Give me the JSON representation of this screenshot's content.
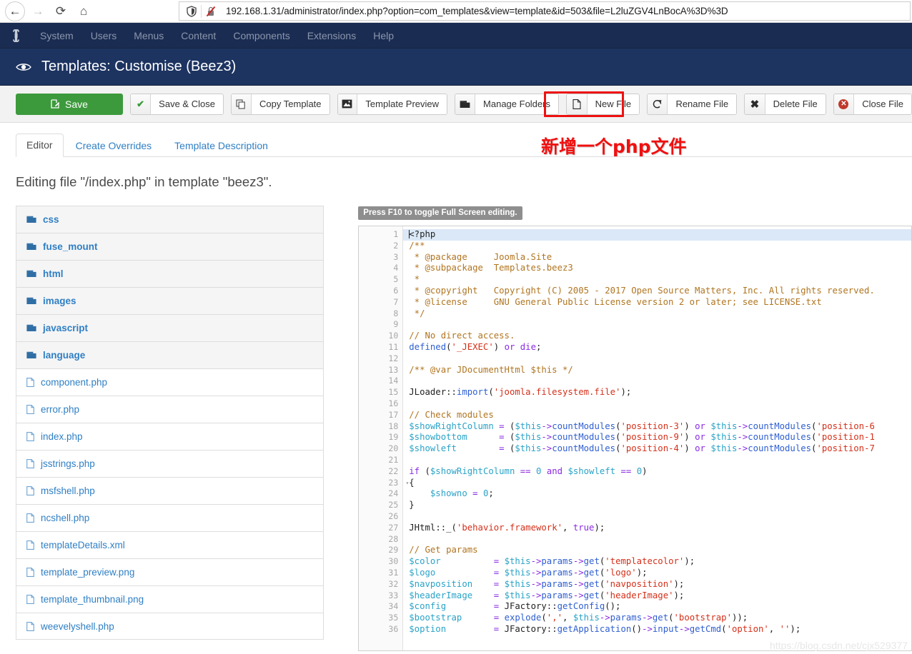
{
  "browser": {
    "back_icon": "back-arrow-icon",
    "forward_icon": "forward-arrow-icon",
    "reload_icon": "reload-icon",
    "home_icon": "home-icon",
    "shield_icon": "shield-icon",
    "insecure_icon": "insecure-lock-icon",
    "url_host": "192.168.1.31",
    "url_path": "/administrator/index.php?option=com_templates&view=template&id=503&file=L2luZGV4LnBocA%3D%3D",
    "url_full": "192.168.1.31/administrator/index.php?option=com_templates&view=template&id=503&file=L2luZGV4LnBocA%3D%3D"
  },
  "admin_nav": {
    "logo_icon": "joomla-logo-icon",
    "items": [
      {
        "label": "System"
      },
      {
        "label": "Users"
      },
      {
        "label": "Menus"
      },
      {
        "label": "Content"
      },
      {
        "label": "Components"
      },
      {
        "label": "Extensions"
      },
      {
        "label": "Help"
      }
    ]
  },
  "page_header": {
    "icon": "eye-icon",
    "title": "Templates: Customise (Beez3)"
  },
  "toolbar": {
    "save_label": "Save",
    "save_close_label": "Save & Close",
    "copy_template_label": "Copy Template",
    "template_preview_label": "Template Preview",
    "manage_folders_label": "Manage Folders",
    "new_file_label": "New File",
    "rename_file_label": "Rename File",
    "delete_file_label": "Delete File",
    "close_file_label": "Close File"
  },
  "annotation": {
    "text": "新增一个php文件",
    "color": "#f01010",
    "highlight_color": "#ee1111",
    "target": "New File"
  },
  "tabs": [
    {
      "label": "Editor",
      "active": true
    },
    {
      "label": "Create Overrides",
      "active": false
    },
    {
      "label": "Template Description",
      "active": false
    }
  ],
  "editing_line": "Editing file \"/index.php\" in template \"beez3\".",
  "file_tree": [
    {
      "name": "css",
      "type": "folder"
    },
    {
      "name": "fuse_mount",
      "type": "folder"
    },
    {
      "name": "html",
      "type": "folder"
    },
    {
      "name": "images",
      "type": "folder"
    },
    {
      "name": "javascript",
      "type": "folder"
    },
    {
      "name": "language",
      "type": "folder"
    },
    {
      "name": "component.php",
      "type": "file"
    },
    {
      "name": "error.php",
      "type": "file"
    },
    {
      "name": "index.php",
      "type": "file"
    },
    {
      "name": "jsstrings.php",
      "type": "file"
    },
    {
      "name": "msfshell.php",
      "type": "file"
    },
    {
      "name": "ncshell.php",
      "type": "file"
    },
    {
      "name": "templateDetails.xml",
      "type": "file"
    },
    {
      "name": "template_preview.png",
      "type": "file"
    },
    {
      "name": "template_thumbnail.png",
      "type": "file"
    },
    {
      "name": "weevelyshell.php",
      "type": "file"
    }
  ],
  "editor": {
    "fullscreen_hint": "Press F10 to toggle Full Screen editing.",
    "highlighted_line": 1,
    "folded_markers": [
      23
    ],
    "lines": [
      {
        "n": 1,
        "text": "<?php"
      },
      {
        "n": 2,
        "text": "/**"
      },
      {
        "n": 3,
        "text": " * @package     Joomla.Site"
      },
      {
        "n": 4,
        "text": " * @subpackage  Templates.beez3"
      },
      {
        "n": 5,
        "text": " *"
      },
      {
        "n": 6,
        "text": " * @copyright   Copyright (C) 2005 - 2017 Open Source Matters, Inc. All rights reserved."
      },
      {
        "n": 7,
        "text": " * @license     GNU General Public License version 2 or later; see LICENSE.txt"
      },
      {
        "n": 8,
        "text": " */"
      },
      {
        "n": 9,
        "text": ""
      },
      {
        "n": 10,
        "text": "// No direct access."
      },
      {
        "n": 11,
        "text": "defined('_JEXEC') or die;"
      },
      {
        "n": 12,
        "text": ""
      },
      {
        "n": 13,
        "text": "/** @var JDocumentHtml $this */"
      },
      {
        "n": 14,
        "text": ""
      },
      {
        "n": 15,
        "text": "JLoader::import('joomla.filesystem.file');"
      },
      {
        "n": 16,
        "text": ""
      },
      {
        "n": 17,
        "text": "// Check modules"
      },
      {
        "n": 18,
        "text": "$showRightColumn = ($this->countModules('position-3') or $this->countModules('position-6"
      },
      {
        "n": 19,
        "text": "$showbottom      = ($this->countModules('position-9') or $this->countModules('position-1"
      },
      {
        "n": 20,
        "text": "$showleft        = ($this->countModules('position-4') or $this->countModules('position-7"
      },
      {
        "n": 21,
        "text": ""
      },
      {
        "n": 22,
        "text": "if ($showRightColumn == 0 and $showleft == 0)"
      },
      {
        "n": 23,
        "text": "{"
      },
      {
        "n": 24,
        "text": "    $showno = 0;"
      },
      {
        "n": 25,
        "text": "}"
      },
      {
        "n": 26,
        "text": ""
      },
      {
        "n": 27,
        "text": "JHtml::_('behavior.framework', true);"
      },
      {
        "n": 28,
        "text": ""
      },
      {
        "n": 29,
        "text": "// Get params"
      },
      {
        "n": 30,
        "text": "$color          = $this->params->get('templatecolor');"
      },
      {
        "n": 31,
        "text": "$logo           = $this->params->get('logo');"
      },
      {
        "n": 32,
        "text": "$navposition    = $this->params->get('navposition');"
      },
      {
        "n": 33,
        "text": "$headerImage    = $this->params->get('headerImage');"
      },
      {
        "n": 34,
        "text": "$config         = JFactory::getConfig();"
      },
      {
        "n": 35,
        "text": "$bootstrap      = explode(',', $this->params->get('bootstrap'));"
      },
      {
        "n": 36,
        "text": "$option         = JFactory::getApplication()->input->getCmd('option', '');"
      }
    ]
  },
  "watermark": "https://blog.csdn.net/cjx529377",
  "colors": {
    "brand_dark": "#1a2c52",
    "header_blue": "#1d3461",
    "save_green": "#3c9a3c",
    "link_blue": "#2f7fc4",
    "annotation_red": "#f01010"
  }
}
